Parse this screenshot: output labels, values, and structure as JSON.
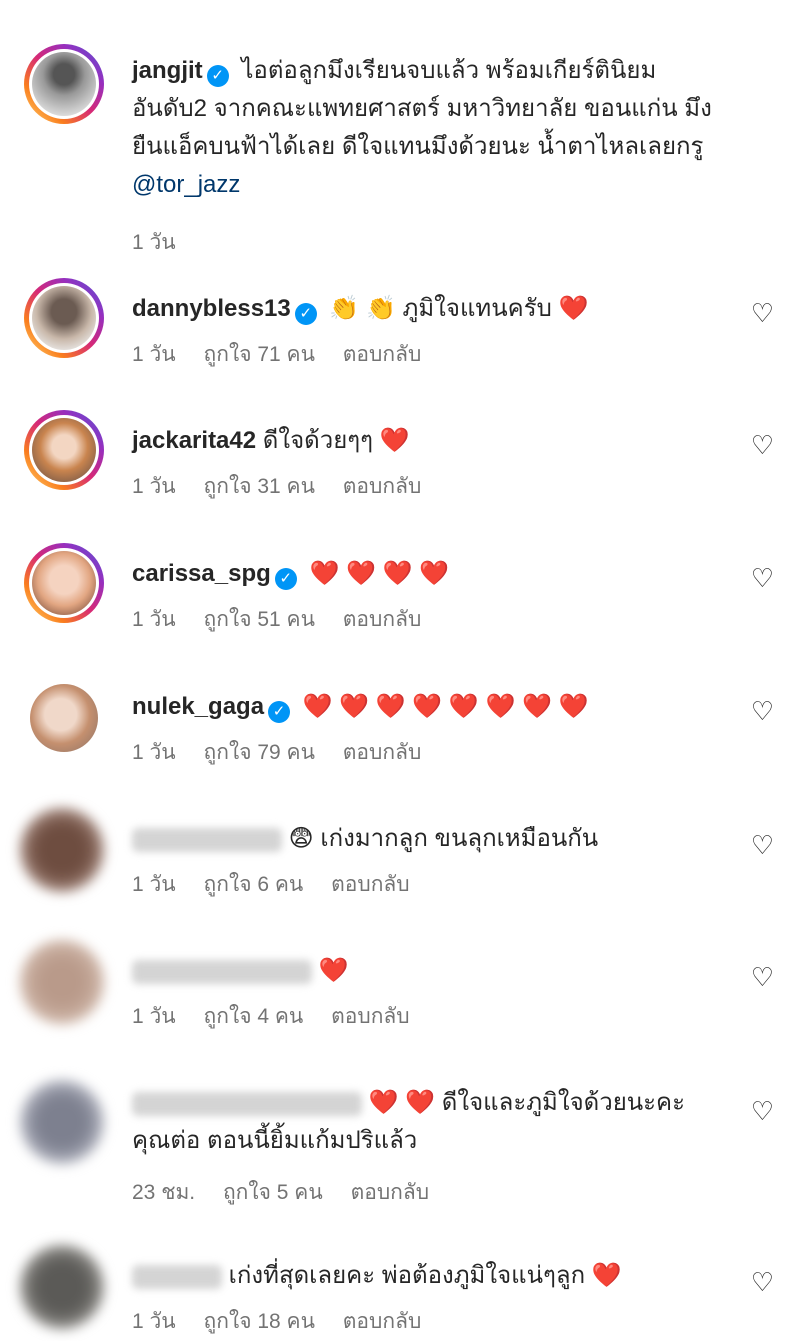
{
  "comments": [
    {
      "username": "jangjit",
      "verified": true,
      "text": "ไอต่อลูกมึงเรียนจบแล้ว พร้อมเกียร์ตินิยมอันดับ2 จากคณะแพทยศาสตร์ มหาวิทยาลัย ขอนแก่น มึงยืนแอ็คบนฟ้าได้เลย ดีใจแทนมึงด้วยนะ น้ำตาไหลเลยกรู",
      "mention": "@tor_jazz",
      "time": "1 วัน"
    },
    {
      "username": "dannybless13",
      "verified": true,
      "text": "👏 👏 ภูมิใจแทนครับ ❤️",
      "time": "1 วัน",
      "likes": "ถูกใจ 71 คน",
      "reply": "ตอบกลับ"
    },
    {
      "username": "jackarita42",
      "verified": false,
      "text": "ดีใจด้วยๆๆ ❤️",
      "time": "1 วัน",
      "likes": "ถูกใจ 31 คน",
      "reply": "ตอบกลับ"
    },
    {
      "username": "carissa_spg",
      "verified": true,
      "text": "❤️ ❤️ ❤️ ❤️",
      "time": "1 วัน",
      "likes": "ถูกใจ 51 คน",
      "reply": "ตอบกลับ"
    },
    {
      "username": "nulek_gaga",
      "verified": true,
      "text": "❤️ ❤️ ❤️ ❤️ ❤️ ❤️ ❤️ ❤️",
      "time": "1 วัน",
      "likes": "ถูกใจ 79 คน",
      "reply": "ตอบกลับ"
    },
    {
      "text": "😨 เก่งมากลูก ขนลุกเหมือนกัน",
      "time": "1 วัน",
      "likes": "ถูกใจ 6 คน",
      "reply": "ตอบกลับ"
    },
    {
      "text": "❤️",
      "time": "1 วัน",
      "likes": "ถูกใจ 4 คน",
      "reply": "ตอบกลับ"
    },
    {
      "text": "❤️ ❤️ ดีใจและภูมิใจด้วยนะคะ คุณต่อ ตอนนี้ยิ้มแก้มปริแล้ว",
      "time": "23 ชม.",
      "likes": "ถูกใจ 5 คน",
      "reply": "ตอบกลับ"
    },
    {
      "text": "เก่งที่สุดเลยคะ พ่อต้องภูมิใจแน่ๆลูก ❤️",
      "time": "1 วัน",
      "likes": "ถูกใจ 18 คน",
      "reply": "ตอบกลับ"
    }
  ],
  "colors": {
    "accent": "#0095f6",
    "heart": "#ed4956",
    "mention": "#00376b",
    "muted": "#737373"
  }
}
